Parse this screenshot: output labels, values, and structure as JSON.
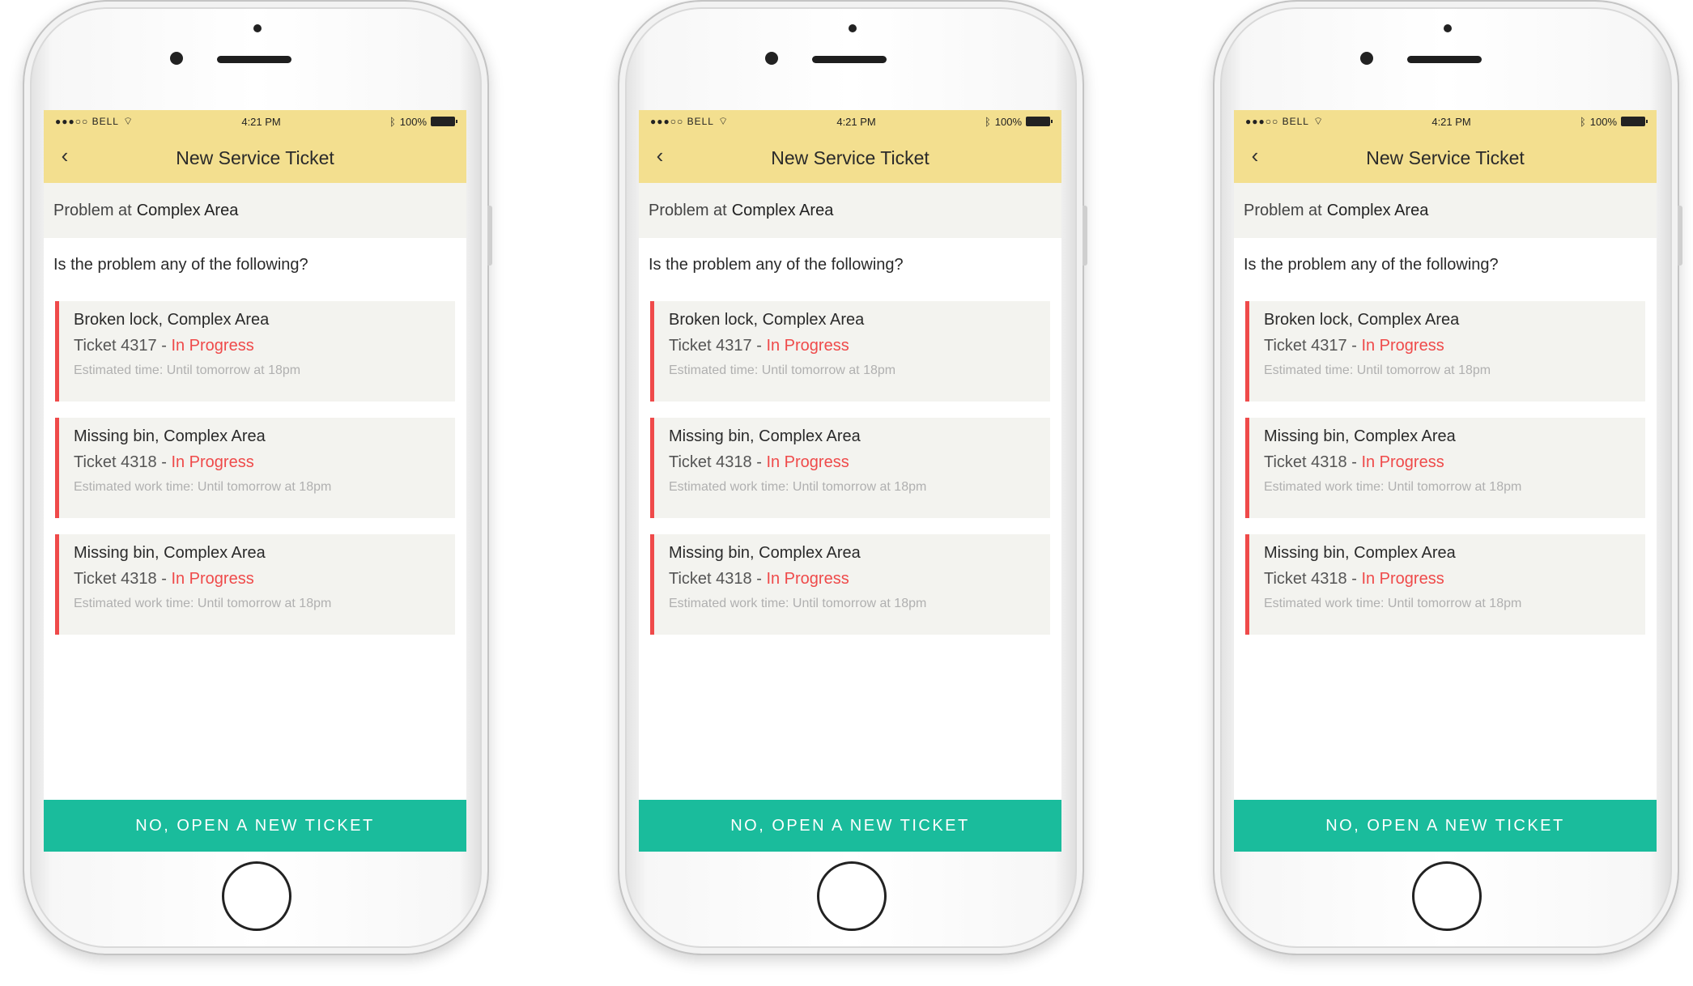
{
  "status_bar": {
    "carrier": "●●●○○ BELL",
    "time": "4:21 PM",
    "battery": "100%"
  },
  "header": {
    "back_label": "‹",
    "title": "New Service Ticket"
  },
  "problem": {
    "prefix": "Problem at",
    "location": "Complex Area"
  },
  "question": "Is the problem any of the following?",
  "tickets": [
    {
      "title": "Broken lock, Complex Area",
      "ticket": "Ticket 4317",
      "sep": " - ",
      "status": "In Progress",
      "estimate": "Estimated time: Until tomorrow at 18pm"
    },
    {
      "title": "Missing bin, Complex Area",
      "ticket": "Ticket 4318",
      "sep": " - ",
      "status": "In Progress",
      "estimate": "Estimated work time: Until tomorrow at 18pm"
    },
    {
      "title": "Missing bin, Complex Area",
      "ticket": "Ticket 4318",
      "sep": " - ",
      "status": "In Progress",
      "estimate": "Estimated work time: Until tomorrow at 18pm"
    }
  ],
  "cta_label": "NO, OPEN A NEW TICKET",
  "colors": {
    "header": "#f3df8f",
    "accent": "#1abc9c",
    "status_red": "#ef4a4a"
  }
}
